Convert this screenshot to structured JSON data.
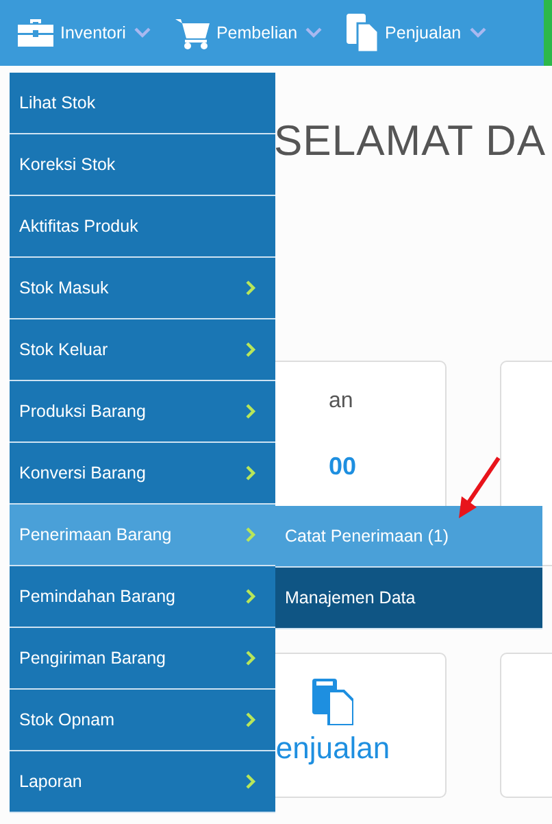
{
  "navbar": {
    "items": [
      {
        "label": "Inventori",
        "kind": "briefcase"
      },
      {
        "label": "Pembelian",
        "kind": "cart"
      },
      {
        "label": "Penjualan",
        "kind": "document"
      }
    ]
  },
  "dropdown": {
    "items": [
      {
        "label": "Lihat Stok",
        "submenu": false,
        "selected": false
      },
      {
        "label": "Koreksi Stok",
        "submenu": false,
        "selected": false
      },
      {
        "label": "Aktifitas Produk",
        "submenu": false,
        "selected": false
      },
      {
        "label": "Stok Masuk",
        "submenu": true,
        "selected": false
      },
      {
        "label": "Stok Keluar",
        "submenu": true,
        "selected": false
      },
      {
        "label": "Produksi Barang",
        "submenu": true,
        "selected": false
      },
      {
        "label": "Konversi Barang",
        "submenu": true,
        "selected": false
      },
      {
        "label": "Penerimaan Barang",
        "submenu": true,
        "selected": true
      },
      {
        "label": "Pemindahan Barang",
        "submenu": true,
        "selected": false
      },
      {
        "label": "Pengiriman Barang",
        "submenu": true,
        "selected": false
      },
      {
        "label": "Stok Opnam",
        "submenu": true,
        "selected": false
      },
      {
        "label": "Laporan",
        "submenu": true,
        "selected": false
      }
    ],
    "submenu": [
      {
        "label": "Catat Penerimaan (1)",
        "selected": true
      },
      {
        "label": "Manajemen Data",
        "selected": false
      }
    ]
  },
  "page": {
    "heading": "SELAMAT DA",
    "card_1": {
      "label": "an",
      "value": "00"
    },
    "card_2": {
      "label": "enjualan"
    }
  }
}
